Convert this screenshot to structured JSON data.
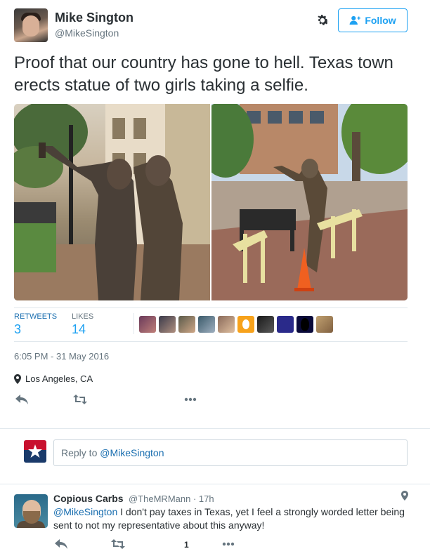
{
  "tweet": {
    "author": {
      "display_name": "Mike Sington",
      "handle": "@MikeSington",
      "avatar_icon": "user-avatar"
    },
    "follow_label": "Follow",
    "settings_icon": "gear-icon",
    "text": "Proof that our country has gone to hell. Texas town erects statue of two girls taking a selfie.",
    "stats": {
      "retweets_label": "RETWEETS",
      "retweets_count": "3",
      "likes_label": "LIKES",
      "likes_count": "14"
    },
    "timestamp": "6:05 PM - 31 May 2016",
    "location": "Los Angeles, CA",
    "actions": [
      "reply-icon",
      "retweet-icon",
      "more-icon"
    ]
  },
  "reply_composer": {
    "placeholder_prefix": "Reply to ",
    "mention": "@MikeSington"
  },
  "replies": [
    {
      "display_name": "Copious Carbs",
      "handle": "@TheMRMann",
      "time": "17h",
      "meta": "@TheMRMann · 17h",
      "mention": "@MikeSington",
      "text": " I don't pay taxes in Texas, yet I feel a strongly worded letter being sent to not my representative about this anyway!",
      "retweet_count": "1"
    }
  ],
  "colors": {
    "link_blue": "#1da1f2",
    "text_dark": "#292f33",
    "text_muted": "#66757f",
    "divider": "#e1e8ed"
  }
}
